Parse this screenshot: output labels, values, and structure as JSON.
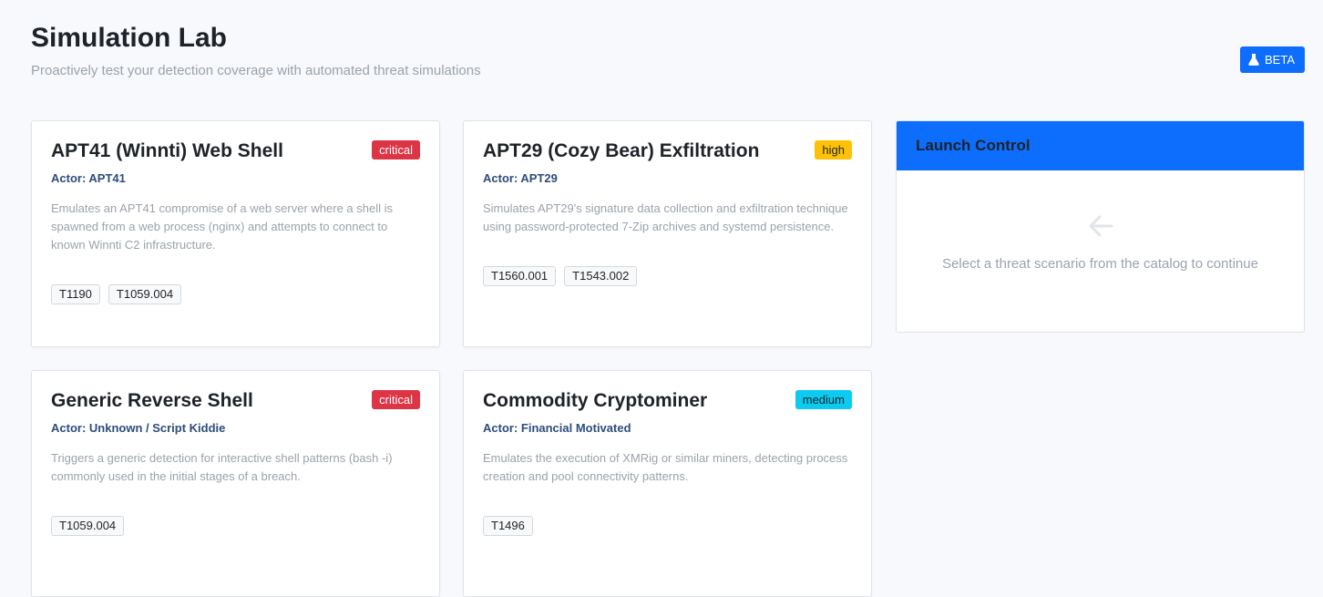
{
  "header": {
    "title": "Simulation Lab",
    "subtitle": "Proactively test your detection coverage with automated threat simulations",
    "badge_label": "BETA",
    "badge_icon": "flask-icon"
  },
  "colors": {
    "primary": "#0d6efd",
    "critical": "#dc3545",
    "high": "#ffc107",
    "medium": "#0dcaf0",
    "actor": "#2d4d7a"
  },
  "scenarios": [
    {
      "title": "APT41 (Winnti) Web Shell",
      "severity": "critical",
      "actor": "Actor: APT41",
      "description": "Emulates an APT41 compromise of a web server where a shell is spawned from a web process (nginx) and attempts to connect to known Winnti C2 infrastructure.",
      "techniques": [
        "T1190",
        "T1059.004"
      ]
    },
    {
      "title": "APT29 (Cozy Bear) Exfiltration",
      "severity": "high",
      "actor": "Actor: APT29",
      "description": "Simulates APT29's signature data collection and exfiltration technique using password-protected 7-Zip archives and systemd persistence.",
      "techniques": [
        "T1560.001",
        "T1543.002"
      ]
    },
    {
      "title": "Generic Reverse Shell",
      "severity": "critical",
      "actor": "Actor: Unknown / Script Kiddie",
      "description": "Triggers a generic detection for interactive shell patterns (bash -i) commonly used in the initial stages of a breach.",
      "techniques": [
        "T1059.004"
      ]
    },
    {
      "title": "Commodity Cryptominer",
      "severity": "medium",
      "actor": "Actor: Financial Motivated",
      "description": "Emulates the execution of XMRig or similar miners, detecting process creation and pool connectivity patterns.",
      "techniques": [
        "T1496"
      ]
    }
  ],
  "launch_control": {
    "title": "Launch Control",
    "hint": "Select a threat scenario from the catalog to continue",
    "icon": "arrow-left-icon"
  }
}
